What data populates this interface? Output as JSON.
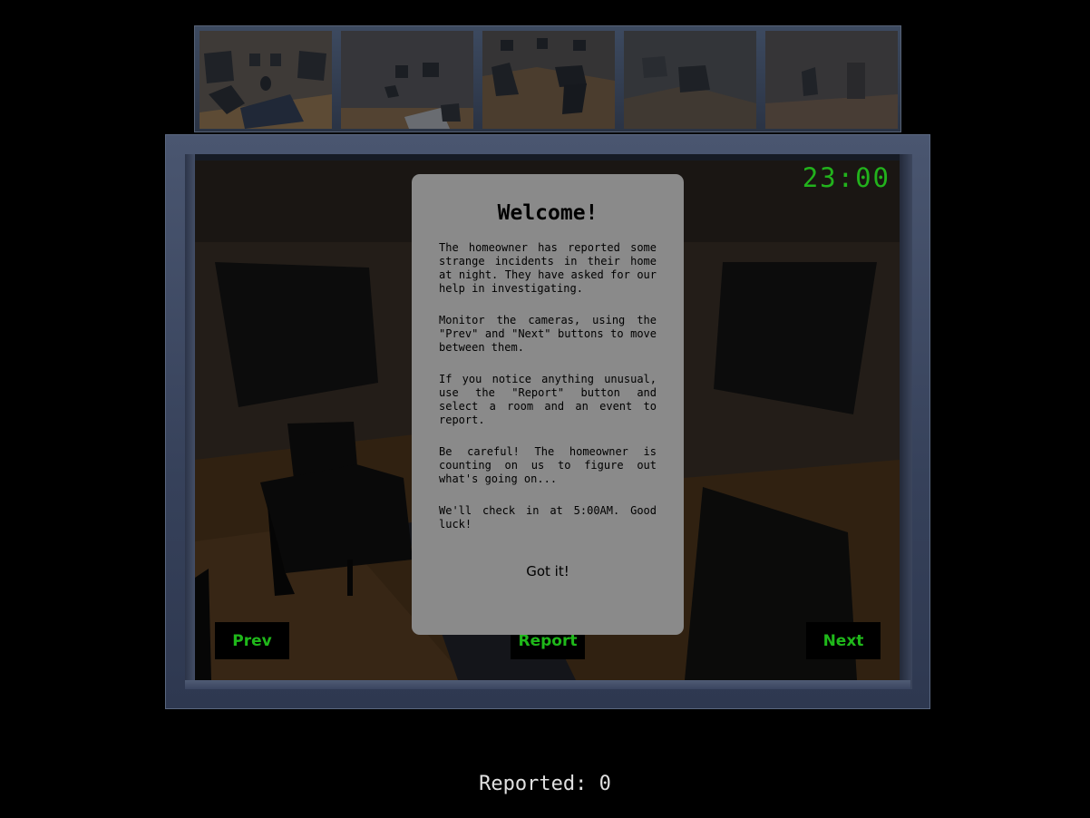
{
  "thumbnails": [
    {
      "room": "camera-1"
    },
    {
      "room": "camera-2"
    },
    {
      "room": "camera-3"
    },
    {
      "room": "camera-4"
    },
    {
      "room": "camera-5"
    }
  ],
  "camera": {
    "clock": "23:00"
  },
  "controls": {
    "prev_label": "Prev",
    "report_label": "Report",
    "next_label": "Next"
  },
  "modal": {
    "title": "Welcome!",
    "paragraphs": [
      "The homeowner has reported some strange incidents in their home at night. They have asked for our help in investigating.",
      "Monitor the cameras, using the \"Prev\" and \"Next\" buttons to move between them.",
      "If you notice anything unusual, use the \"Report\" button and select a room and an event to report.",
      "Be careful! The homeowner is counting on us to figure out what's going on...",
      "We'll check in at 5:00AM. Good luck!"
    ],
    "button_label": "Got it!"
  },
  "status": {
    "reported_text": "Reported: 0"
  },
  "colors": {
    "accent_green": "#22b21c",
    "frame": "#3d4a60",
    "modal_bg": "#8a8a8a"
  }
}
